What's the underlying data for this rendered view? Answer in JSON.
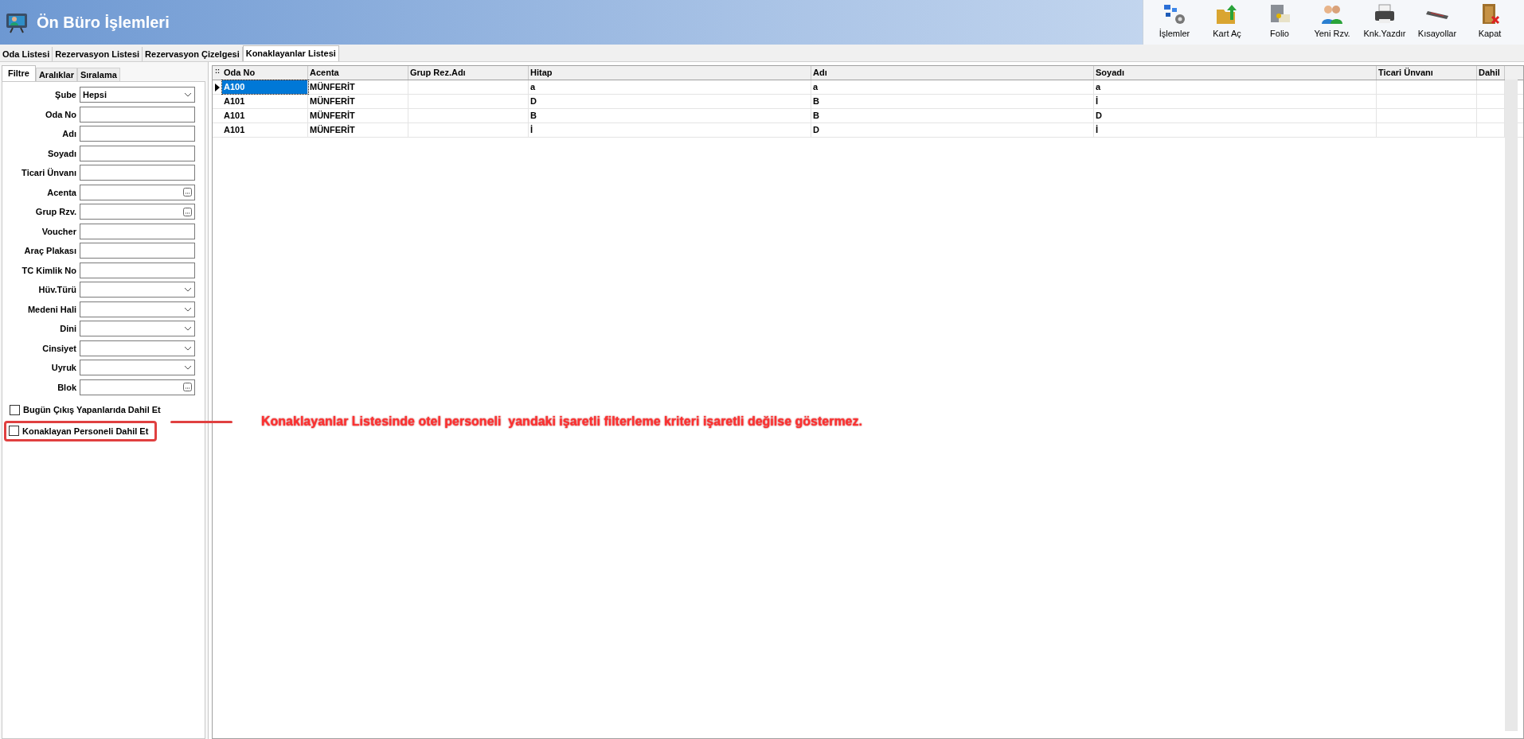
{
  "window": {
    "title": "Ön Büro İşlemleri"
  },
  "toolbar": [
    {
      "kind": "gears",
      "label": "İşlemler"
    },
    {
      "kind": "folder",
      "label": "Kart Aç"
    },
    {
      "kind": "safe",
      "label": "Folio"
    },
    {
      "kind": "people",
      "label": "Yeni Rzv."
    },
    {
      "kind": "printer",
      "label": "Knk.Yazdır"
    },
    {
      "kind": "keyboard",
      "label": "Kısayollar"
    },
    {
      "kind": "door",
      "label": "Kapat"
    }
  ],
  "tabs": [
    {
      "label": "Oda Listesi",
      "selected": false
    },
    {
      "label": "Rezervasyon Listesi",
      "selected": false
    },
    {
      "label": "Rezervasyon Çizelgesi",
      "selected": false
    },
    {
      "label": "Konaklayanlar Listesi",
      "selected": true
    }
  ],
  "filter_tabs": [
    {
      "label": "Filtre",
      "selected": true
    },
    {
      "label": "Aralıklar",
      "selected": false
    },
    {
      "label": "Sıralama",
      "selected": false
    }
  ],
  "filters": [
    {
      "label": "Şube",
      "kind": "dropdown",
      "value": "Hepsi"
    },
    {
      "label": "Oda No",
      "kind": "text"
    },
    {
      "label": "Adı",
      "kind": "text"
    },
    {
      "label": "Soyadı",
      "kind": "text"
    },
    {
      "label": "Ticari Ünvanı",
      "kind": "text"
    },
    {
      "label": "Acenta",
      "kind": "lookup"
    },
    {
      "label": "Grup Rzv.",
      "kind": "lookup"
    },
    {
      "label": "Voucher",
      "kind": "text"
    },
    {
      "label": "Araç Plakası",
      "kind": "text"
    },
    {
      "label": "TC Kimlik No",
      "kind": "text"
    },
    {
      "label": "Hüv.Türü",
      "kind": "dropdown"
    },
    {
      "label": "Medeni Hali",
      "kind": "dropdown"
    },
    {
      "label": "Dini",
      "kind": "dropdown"
    },
    {
      "label": "Cinsiyet",
      "kind": "dropdown"
    },
    {
      "label": "Uyruk",
      "kind": "dropdown"
    },
    {
      "label": "Blok",
      "kind": "lookup"
    }
  ],
  "checkboxes": [
    {
      "label": "Bugün Çıkış Yapanlarıda Dahil Et",
      "checked": false,
      "highlighted": false
    },
    {
      "label": "Konaklayan Personeli Dahil Et",
      "checked": false,
      "highlighted": true
    }
  ],
  "table": {
    "corner_mark": "::",
    "columns": [
      "Oda No",
      "Acenta",
      "Grup Rez.Adı",
      "Hitap",
      "Adı",
      "Soyadı",
      "Ticari Ünvanı",
      "Dahil"
    ],
    "rows": [
      {
        "selected": true,
        "cells": [
          "A100",
          "MÜNFERİT",
          "",
          "a",
          "a",
          "a",
          "",
          ""
        ]
      },
      {
        "selected": false,
        "cells": [
          "A101",
          "MÜNFERİT",
          "",
          "D",
          "B",
          "İ",
          "",
          ""
        ]
      },
      {
        "selected": false,
        "cells": [
          "A101",
          "MÜNFERİT",
          "",
          "B",
          "B",
          "D",
          "",
          ""
        ]
      },
      {
        "selected": false,
        "cells": [
          "A101",
          "MÜNFERİT",
          "",
          "İ",
          "D",
          "İ",
          "",
          ""
        ]
      }
    ]
  },
  "annotation": "Konaklayanlar Listesinde otel personeli  yandaki işaretli filterleme kriteri işaretli değilse göstermez."
}
